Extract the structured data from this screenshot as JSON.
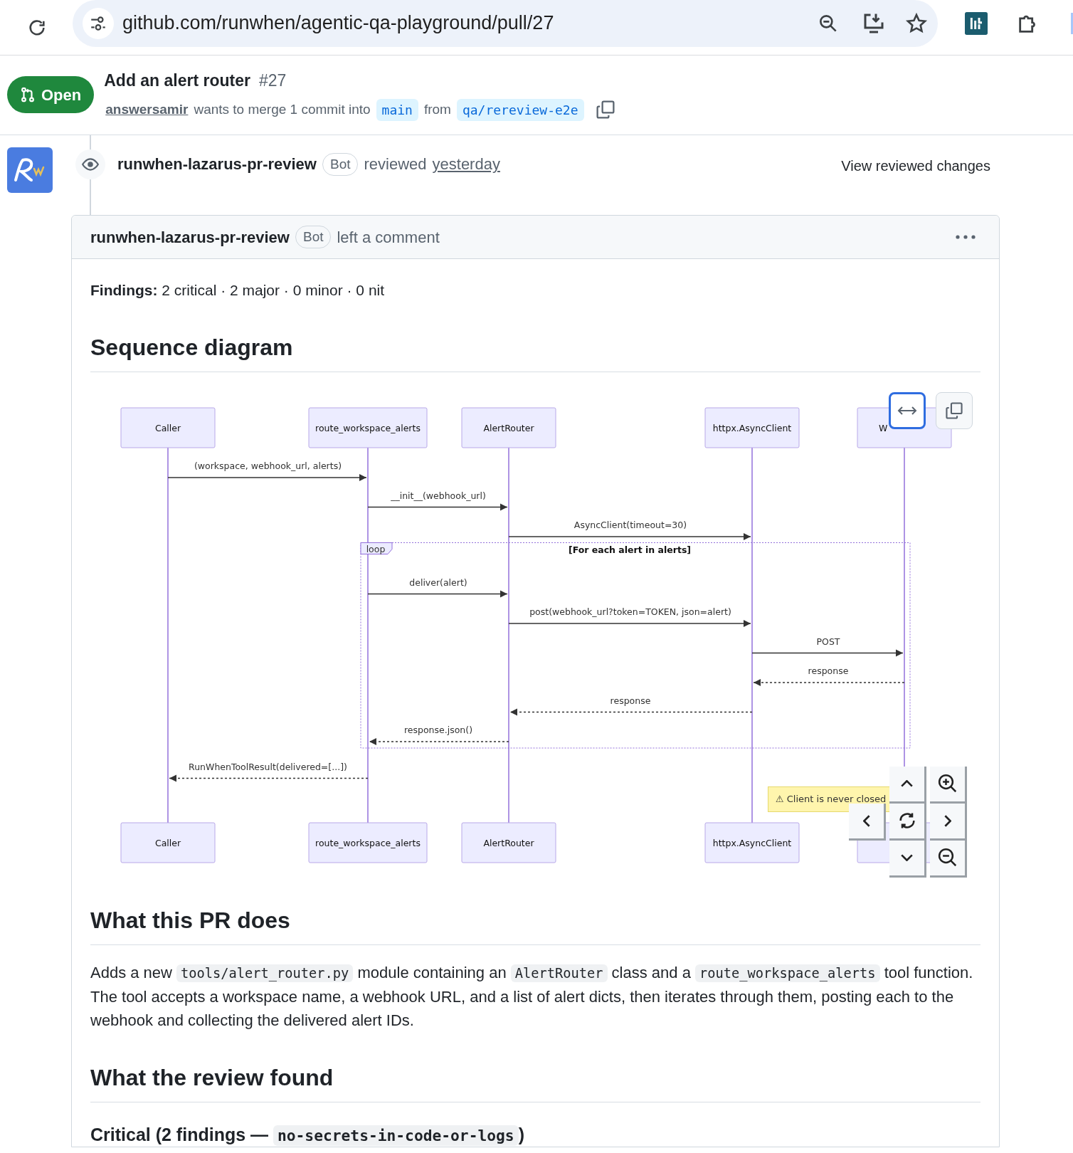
{
  "browser": {
    "url": "github.com/runwhen/agentic-qa-playground/pull/27"
  },
  "pr": {
    "state": "Open",
    "title": "Add an alert router",
    "number": "#27",
    "author": "answersamir",
    "merge_text": "wants to merge 1 commit into",
    "base": "main",
    "from_text": "from",
    "head": "qa/rereview-e2e"
  },
  "review": {
    "reviewer": "runwhen-lazarus-pr-review",
    "badge": "Bot",
    "action": "reviewed",
    "time": "yesterday",
    "view_link": "View reviewed changes"
  },
  "comment": {
    "author": "runwhen-lazarus-pr-review",
    "badge": "Bot",
    "action": "left a comment",
    "findings_label": "Findings:",
    "findings": "2 critical · 2 major · 0 minor · 0 nit",
    "diagram_heading": "Sequence diagram",
    "diagram": {
      "top_participants": [
        "Caller",
        "route_workspace_alerts",
        "AlertRouter",
        "httpx.AsyncClient",
        "W"
      ],
      "bottom_participants": [
        "Caller",
        "route_workspace_alerts",
        "AlertRouter",
        "httpx.AsyncClient"
      ],
      "messages_before": [
        {
          "label": "(workspace, webhook_url, alerts)",
          "kind": "call"
        },
        {
          "label": "__init__(webhook_url)",
          "kind": "call"
        },
        {
          "label": "AsyncClient(timeout=30)",
          "kind": "call"
        }
      ],
      "loop": {
        "label": "loop",
        "condition": "[For each alert in alerts]",
        "messages": [
          {
            "label": "deliver(alert)",
            "kind": "call"
          },
          {
            "label": "post(webhook_url?token=TOKEN, json=alert)",
            "kind": "call"
          },
          {
            "label": "POST",
            "kind": "call"
          },
          {
            "label": "response",
            "kind": "reply"
          },
          {
            "label": "response",
            "kind": "reply"
          },
          {
            "label": "response.json()",
            "kind": "reply"
          }
        ]
      },
      "messages_after": [
        {
          "label": "RunWhenToolResult(delivered=[...])",
          "kind": "reply"
        }
      ],
      "note": "⚠ Client is never closed"
    },
    "sections": [
      {
        "heading": "What this PR does",
        "paragraph": [
          {
            "kind": "text",
            "text": "Adds a new "
          },
          {
            "kind": "code",
            "text": "tools/alert_router.py"
          },
          {
            "kind": "text",
            "text": " module containing an "
          },
          {
            "kind": "code",
            "text": "AlertRouter"
          },
          {
            "kind": "text",
            "text": " class and a "
          },
          {
            "kind": "code",
            "text": "route_workspace_alerts"
          },
          {
            "kind": "text",
            "text": " tool function. The tool accepts a workspace name, a webhook URL, and a list of alert dicts, then iterates through them, posting each to the webhook and collecting the delivered alert IDs."
          }
        ]
      },
      {
        "heading": "What the review found",
        "subheading": [
          {
            "kind": "text",
            "text": "Critical (2 findings — "
          },
          {
            "kind": "code",
            "text": "no-secrets-in-code-or-logs"
          },
          {
            "kind": "text",
            "text": ")"
          }
        ]
      }
    ]
  }
}
